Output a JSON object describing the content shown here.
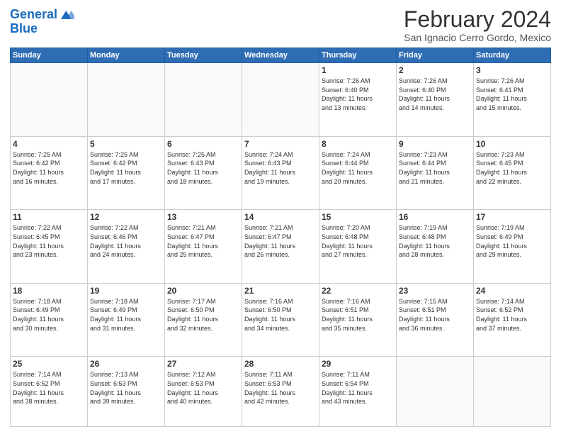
{
  "header": {
    "logo_line1": "General",
    "logo_line2": "Blue",
    "main_title": "February 2024",
    "sub_title": "San Ignacio Cerro Gordo, Mexico"
  },
  "weekdays": [
    "Sunday",
    "Monday",
    "Tuesday",
    "Wednesday",
    "Thursday",
    "Friday",
    "Saturday"
  ],
  "weeks": [
    [
      {
        "day": "",
        "info": ""
      },
      {
        "day": "",
        "info": ""
      },
      {
        "day": "",
        "info": ""
      },
      {
        "day": "",
        "info": ""
      },
      {
        "day": "1",
        "info": "Sunrise: 7:26 AM\nSunset: 6:40 PM\nDaylight: 11 hours\nand 13 minutes."
      },
      {
        "day": "2",
        "info": "Sunrise: 7:26 AM\nSunset: 6:40 PM\nDaylight: 11 hours\nand 14 minutes."
      },
      {
        "day": "3",
        "info": "Sunrise: 7:26 AM\nSunset: 6:41 PM\nDaylight: 11 hours\nand 15 minutes."
      }
    ],
    [
      {
        "day": "4",
        "info": "Sunrise: 7:25 AM\nSunset: 6:42 PM\nDaylight: 11 hours\nand 16 minutes."
      },
      {
        "day": "5",
        "info": "Sunrise: 7:25 AM\nSunset: 6:42 PM\nDaylight: 11 hours\nand 17 minutes."
      },
      {
        "day": "6",
        "info": "Sunrise: 7:25 AM\nSunset: 6:43 PM\nDaylight: 11 hours\nand 18 minutes."
      },
      {
        "day": "7",
        "info": "Sunrise: 7:24 AM\nSunset: 6:43 PM\nDaylight: 11 hours\nand 19 minutes."
      },
      {
        "day": "8",
        "info": "Sunrise: 7:24 AM\nSunset: 6:44 PM\nDaylight: 11 hours\nand 20 minutes."
      },
      {
        "day": "9",
        "info": "Sunrise: 7:23 AM\nSunset: 6:44 PM\nDaylight: 11 hours\nand 21 minutes."
      },
      {
        "day": "10",
        "info": "Sunrise: 7:23 AM\nSunset: 6:45 PM\nDaylight: 11 hours\nand 22 minutes."
      }
    ],
    [
      {
        "day": "11",
        "info": "Sunrise: 7:22 AM\nSunset: 6:45 PM\nDaylight: 11 hours\nand 23 minutes."
      },
      {
        "day": "12",
        "info": "Sunrise: 7:22 AM\nSunset: 6:46 PM\nDaylight: 11 hours\nand 24 minutes."
      },
      {
        "day": "13",
        "info": "Sunrise: 7:21 AM\nSunset: 6:47 PM\nDaylight: 11 hours\nand 25 minutes."
      },
      {
        "day": "14",
        "info": "Sunrise: 7:21 AM\nSunset: 6:47 PM\nDaylight: 11 hours\nand 26 minutes."
      },
      {
        "day": "15",
        "info": "Sunrise: 7:20 AM\nSunset: 6:48 PM\nDaylight: 11 hours\nand 27 minutes."
      },
      {
        "day": "16",
        "info": "Sunrise: 7:19 AM\nSunset: 6:48 PM\nDaylight: 11 hours\nand 28 minutes."
      },
      {
        "day": "17",
        "info": "Sunrise: 7:19 AM\nSunset: 6:49 PM\nDaylight: 11 hours\nand 29 minutes."
      }
    ],
    [
      {
        "day": "18",
        "info": "Sunrise: 7:18 AM\nSunset: 6:49 PM\nDaylight: 11 hours\nand 30 minutes."
      },
      {
        "day": "19",
        "info": "Sunrise: 7:18 AM\nSunset: 6:49 PM\nDaylight: 11 hours\nand 31 minutes."
      },
      {
        "day": "20",
        "info": "Sunrise: 7:17 AM\nSunset: 6:50 PM\nDaylight: 11 hours\nand 32 minutes."
      },
      {
        "day": "21",
        "info": "Sunrise: 7:16 AM\nSunset: 6:50 PM\nDaylight: 11 hours\nand 34 minutes."
      },
      {
        "day": "22",
        "info": "Sunrise: 7:16 AM\nSunset: 6:51 PM\nDaylight: 11 hours\nand 35 minutes."
      },
      {
        "day": "23",
        "info": "Sunrise: 7:15 AM\nSunset: 6:51 PM\nDaylight: 11 hours\nand 36 minutes."
      },
      {
        "day": "24",
        "info": "Sunrise: 7:14 AM\nSunset: 6:52 PM\nDaylight: 11 hours\nand 37 minutes."
      }
    ],
    [
      {
        "day": "25",
        "info": "Sunrise: 7:14 AM\nSunset: 6:52 PM\nDaylight: 11 hours\nand 38 minutes."
      },
      {
        "day": "26",
        "info": "Sunrise: 7:13 AM\nSunset: 6:53 PM\nDaylight: 11 hours\nand 39 minutes."
      },
      {
        "day": "27",
        "info": "Sunrise: 7:12 AM\nSunset: 6:53 PM\nDaylight: 11 hours\nand 40 minutes."
      },
      {
        "day": "28",
        "info": "Sunrise: 7:11 AM\nSunset: 6:53 PM\nDaylight: 11 hours\nand 42 minutes."
      },
      {
        "day": "29",
        "info": "Sunrise: 7:11 AM\nSunset: 6:54 PM\nDaylight: 11 hours\nand 43 minutes."
      },
      {
        "day": "",
        "info": ""
      },
      {
        "day": "",
        "info": ""
      }
    ]
  ]
}
